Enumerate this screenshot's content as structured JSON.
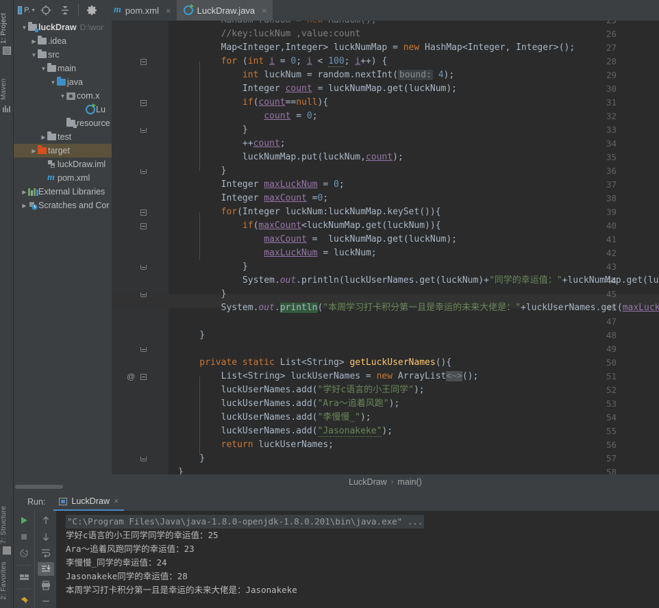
{
  "toolbar": {
    "project_selector_label": "P.",
    "icons": [
      "project-select-icon",
      "locate-icon",
      "collapse-all-icon",
      "settings-gear-icon"
    ]
  },
  "tabs": [
    {
      "label": "pom.xml",
      "icon": "maven-m-icon",
      "active": false,
      "close": "×"
    },
    {
      "label": "LuckDraw.java",
      "icon": "java-class-icon",
      "active": true,
      "close": "×"
    }
  ],
  "left_strip": {
    "project_label": "1: Project",
    "maven_label": "Maven",
    "structure_label": "7: Structure",
    "favorites_label": "2: Favorites"
  },
  "tree": [
    {
      "indent": 0,
      "arrow": "▼",
      "icon": "module-folder",
      "label": "luckDraw",
      "bold": true,
      "dim": "D:\\wor",
      "selected": false
    },
    {
      "indent": 1,
      "arrow": "▶",
      "icon": "folder-grey",
      "label": ".idea",
      "bold": false,
      "dim": "",
      "selected": false
    },
    {
      "indent": 1,
      "arrow": "▼",
      "icon": "folder-grey",
      "label": "src",
      "bold": false,
      "dim": "",
      "selected": false
    },
    {
      "indent": 2,
      "arrow": "▼",
      "icon": "folder-grey",
      "label": "main",
      "bold": false,
      "dim": "",
      "selected": false
    },
    {
      "indent": 3,
      "arrow": "▼",
      "icon": "folder-blue",
      "label": "java",
      "bold": false,
      "dim": "",
      "selected": false
    },
    {
      "indent": 4,
      "arrow": "▼",
      "icon": "package-icon",
      "label": "com.x",
      "bold": false,
      "dim": "",
      "selected": false
    },
    {
      "indent": 5,
      "arrow": "",
      "icon": "java-class-icon",
      "label": "Lu",
      "bold": false,
      "dim": "",
      "selected": false
    },
    {
      "indent": 4,
      "arrow": "",
      "icon": "resources-folder",
      "label": "resource",
      "bold": false,
      "dim": "",
      "selected": false
    },
    {
      "indent": 2,
      "arrow": "▶",
      "icon": "folder-grey",
      "label": "test",
      "bold": false,
      "dim": "",
      "selected": false
    },
    {
      "indent": 1,
      "arrow": "▶",
      "icon": "folder-orange",
      "label": "target",
      "bold": false,
      "dim": "",
      "selected": true
    },
    {
      "indent": 2,
      "arrow": "",
      "icon": "iml-file-icon",
      "label": "luckDraw.iml",
      "bold": false,
      "dim": "",
      "selected": false
    },
    {
      "indent": 2,
      "arrow": "",
      "icon": "maven-m-icon",
      "label": "pom.xml",
      "bold": false,
      "dim": "",
      "selected": false
    },
    {
      "indent": 0,
      "arrow": "▶",
      "icon": "library-icon",
      "label": "External Libraries",
      "bold": false,
      "dim": "",
      "selected": false
    },
    {
      "indent": 0,
      "arrow": "▶",
      "icon": "scratches-icon",
      "label": "Scratches and Cor",
      "bold": false,
      "dim": "",
      "selected": false
    }
  ],
  "editor": {
    "first_line": 25,
    "current_line": 44,
    "file": "LuckDraw.java",
    "lines": [
      {
        "n": 25,
        "clipped": true
      },
      {
        "n": 26
      },
      {
        "n": 27
      },
      {
        "n": 28,
        "fold": "start"
      },
      {
        "n": 29
      },
      {
        "n": 30
      },
      {
        "n": 31,
        "fold": "start"
      },
      {
        "n": 32
      },
      {
        "n": 33,
        "fold": "end"
      },
      {
        "n": 34
      },
      {
        "n": 35
      },
      {
        "n": 36,
        "fold": "end"
      },
      {
        "n": 37
      },
      {
        "n": 38
      },
      {
        "n": 39,
        "fold": "start"
      },
      {
        "n": 40,
        "fold": "start"
      },
      {
        "n": 41
      },
      {
        "n": 42
      },
      {
        "n": 43,
        "fold": "end"
      },
      {
        "n": 44
      },
      {
        "n": 45,
        "fold": "end"
      },
      {
        "n": 46
      },
      {
        "n": 47
      },
      {
        "n": 48,
        "fold": "end"
      },
      {
        "n": 49
      },
      {
        "n": 50,
        "fold": "start",
        "gutter_mark": "@"
      },
      {
        "n": 51
      },
      {
        "n": 52
      },
      {
        "n": 53
      },
      {
        "n": 54
      },
      {
        "n": 55
      },
      {
        "n": 56
      },
      {
        "n": 57,
        "fold": "end"
      },
      {
        "n": 58
      }
    ],
    "code_text": [
      "Random random = new Random();",
      "//key:luckNum ,value:count",
      "Map<Integer,Integer> luckNumMap = new HashMap<Integer, Integer>();",
      "for (int i = 0; i < 100; i++) {",
      "int luckNum = random.nextInt( bound: 4);",
      "Integer count = luckNumMap.get(luckNum);",
      "if(count==null){",
      "count = 0;",
      "}",
      "++count;",
      "luckNumMap.put(luckNum,count);",
      "}",
      "Integer maxLuckNum = 0;",
      "Integer maxCount =0;",
      "for(Integer luckNum:luckNumMap.keySet()){",
      "if(maxCount<luckNumMap.get(luckNum)){",
      "maxCount =  luckNumMap.get(luckNum);",
      "maxLuckNum = luckNum;",
      "}",
      "System.out.println(luckUserNames.get(luckNum)+\"同学的幸运值：\"+luckNumMap.get(luckNum));",
      "}",
      "System.out.println(\"本周学习打卡积分第一且是幸运的未来大佬是：\"+luckUserNames.get(maxLuckNum));",
      "",
      "}",
      "",
      "private static List<String> getLuckUserNames(){",
      "List<String> luckUserNames = new ArrayList<~>();",
      "luckUserNames.add(\"学好c语言的小王同学\");",
      "luckUserNames.add(\"Ara～追着风跑\");",
      "luckUserNames.add(\"李慢慢_\");",
      "luckUserNames.add(\"Jasonakeke\");",
      "return luckUserNames;",
      "}",
      "}"
    ]
  },
  "breadcrumb": {
    "parts": [
      "LuckDraw",
      "main()"
    ],
    "separator": "›"
  },
  "run_window": {
    "label": "Run:",
    "tab_label": "LuckDraw",
    "tab_close": "×",
    "tool_icons_left": [
      "rerun-play-icon",
      "stop-icon",
      "rerun-failed-icon",
      "layout-icon",
      "pin-icon"
    ],
    "tool_icons_right": [
      "up-arrow-icon",
      "down-arrow-icon",
      "soft-wrap-icon",
      "scroll-to-end-icon",
      "print-icon",
      "more-icon"
    ],
    "console_lines": [
      {
        "text": "\"C:\\Program Files\\Java\\java-1.8.0-openjdk-1.8.0.201\\bin\\java.exe\" ...",
        "style": "command"
      },
      {
        "text": "学好c语言的小王同学同学的幸运值：25",
        "style": "normal"
      },
      {
        "text": "Ara～追着风跑同学的幸运值：23",
        "style": "normal"
      },
      {
        "text": "李慢慢_同学的幸运值：24",
        "style": "normal"
      },
      {
        "text": "Jasonakeke同学的幸运值：28",
        "style": "normal"
      },
      {
        "text": "本周学习打卡积分第一且是幸运的未来大佬是：Jasonakeke",
        "style": "normal"
      }
    ]
  },
  "colors": {
    "background": "#3c3f41",
    "editor_background": "#2b2b2b",
    "gutter": "#313335",
    "accent_blue": "#4a88c7",
    "keyword_orange": "#cc7832",
    "string_green": "#6a8759",
    "number_blue": "#6897bb",
    "field_purple": "#9876aa",
    "method_yellow": "#ffc66d",
    "selection_brown": "#5c513a",
    "text": "#a9b7c6"
  }
}
